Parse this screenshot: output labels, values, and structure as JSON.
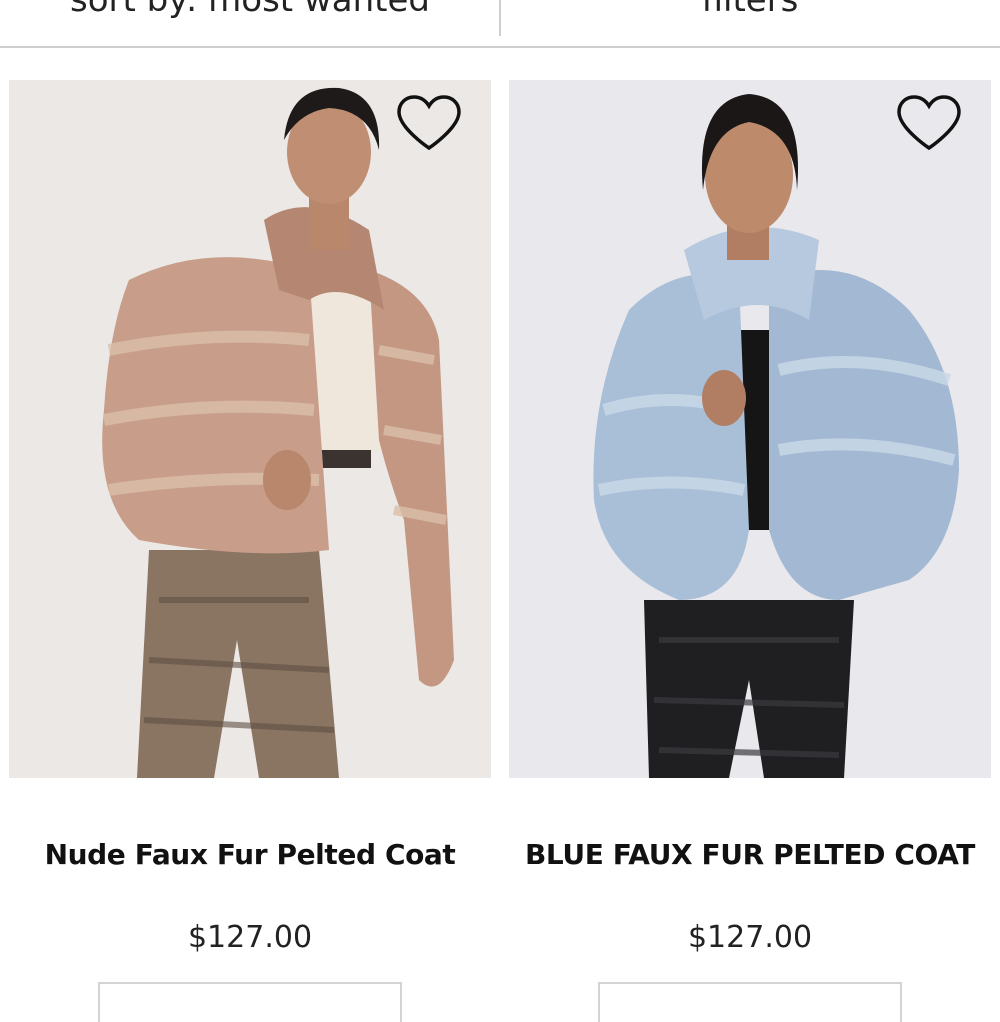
{
  "toolbar": {
    "sort_label": "sort by: most wanted",
    "filters_label": "filters"
  },
  "products": [
    {
      "name": "Nude Faux Fur Pelted Coat",
      "price": "$127.00",
      "coat_color": "#c89e8a",
      "image_desc_icon": "photo-icon"
    },
    {
      "name": "BLUE FAUX FUR PELTED COAT",
      "price": "$127.00",
      "coat_color": "#a9bfd8",
      "image_desc_icon": "photo-icon"
    }
  ],
  "icons": {
    "wishlist": "heart-icon"
  }
}
